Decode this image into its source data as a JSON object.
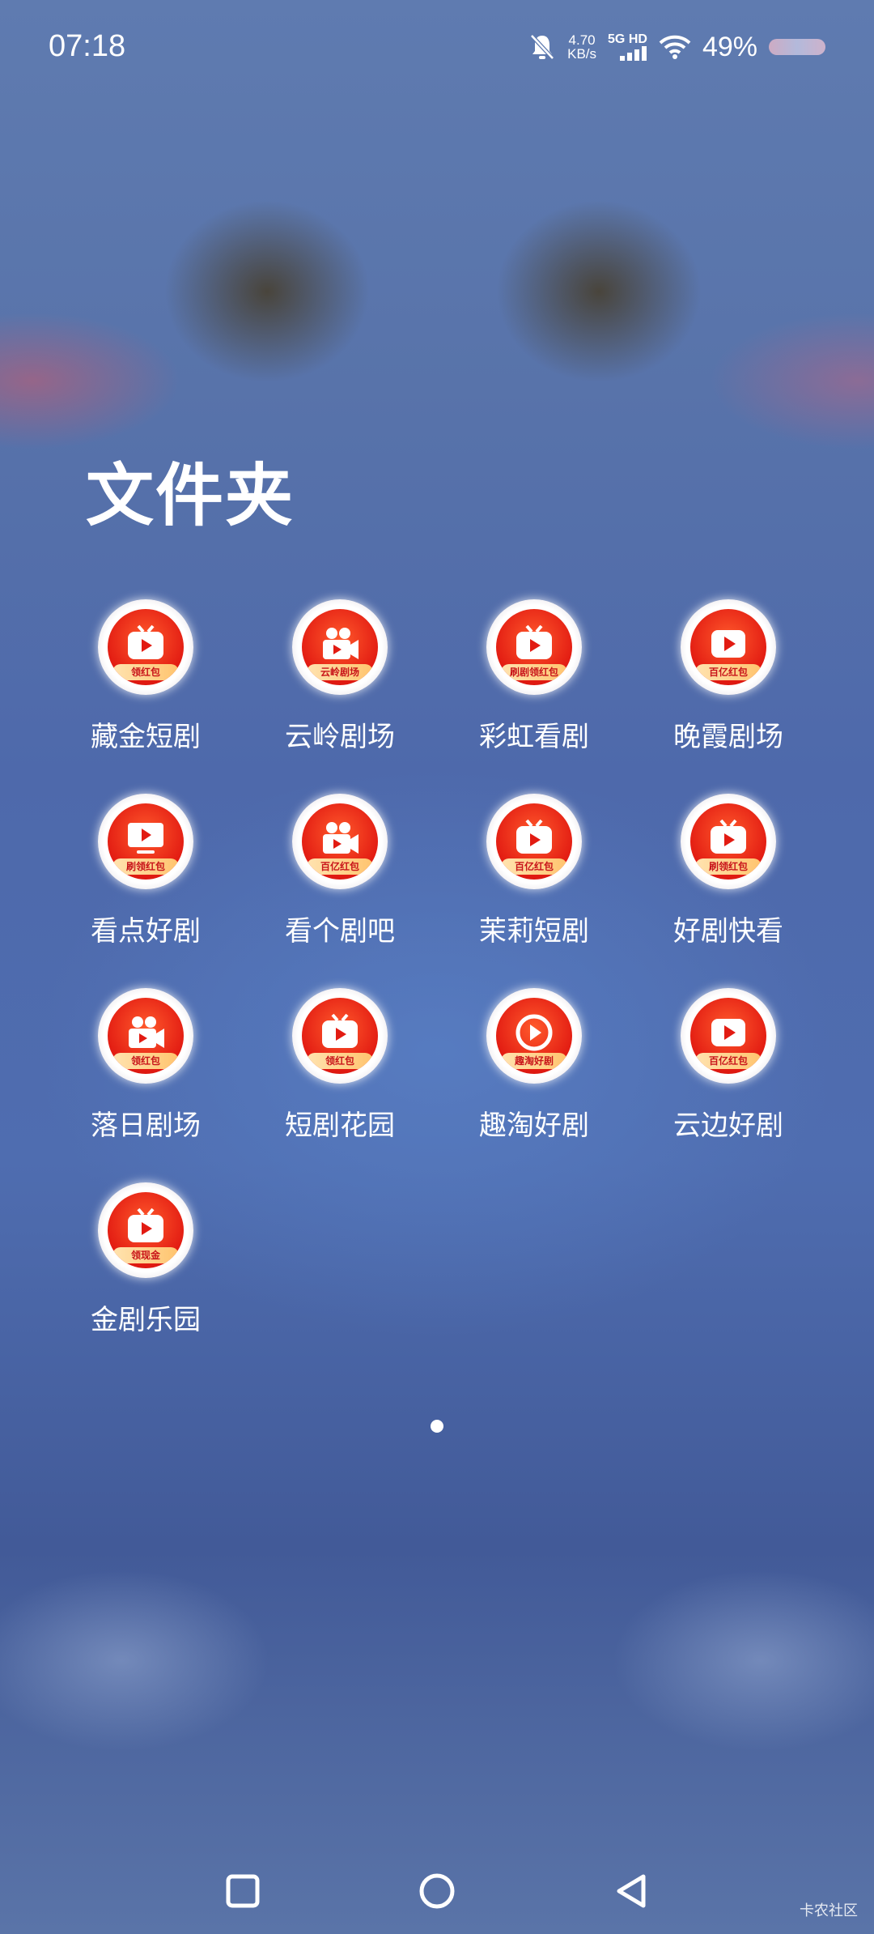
{
  "status_bar": {
    "time": "07:18",
    "network_speed_value": "4.70",
    "network_speed_unit": "KB/s",
    "network_type": "5G HD",
    "battery": "49%"
  },
  "folder": {
    "title": "文件夹",
    "apps": [
      {
        "label": "藏金短剧",
        "badge": "领红包",
        "glyph": "tv"
      },
      {
        "label": "云岭剧场",
        "badge": "云岭剧场",
        "glyph": "camera"
      },
      {
        "label": "彩虹看剧",
        "badge": "刷剧领红包",
        "glyph": "tv"
      },
      {
        "label": "晚霞剧场",
        "badge": "百亿红包",
        "glyph": "play"
      },
      {
        "label": "看点好剧",
        "badge": "刷领红包",
        "glyph": "monitor"
      },
      {
        "label": "看个剧吧",
        "badge": "百亿红包",
        "glyph": "camera"
      },
      {
        "label": "茉莉短剧",
        "badge": "百亿红包",
        "glyph": "tv"
      },
      {
        "label": "好剧快看",
        "badge": "刷领红包",
        "glyph": "tv"
      },
      {
        "label": "落日剧场",
        "badge": "领红包",
        "glyph": "camera"
      },
      {
        "label": "短剧花园",
        "badge": "领红包",
        "glyph": "tv"
      },
      {
        "label": "趣淘好剧",
        "badge": "趣淘好剧",
        "glyph": "circle-play"
      },
      {
        "label": "云边好剧",
        "badge": "百亿红包",
        "glyph": "play"
      },
      {
        "label": "金剧乐园",
        "badge": "领现金",
        "glyph": "tv"
      }
    ]
  },
  "pager": {
    "current": 1,
    "total": 1
  },
  "watermark": "卡农社区"
}
